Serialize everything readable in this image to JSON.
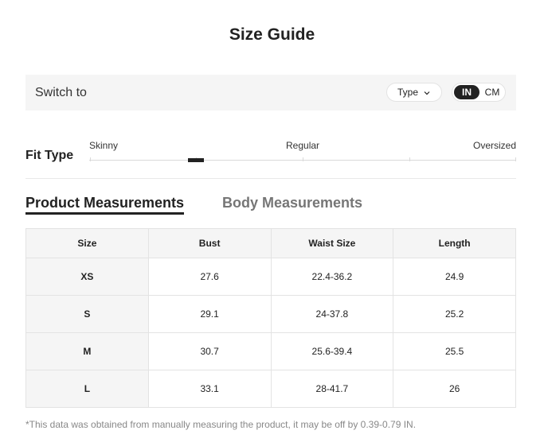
{
  "title": "Size Guide",
  "switch_bar": {
    "label": "Switch to",
    "type_dropdown": "Type",
    "unit_in": "IN",
    "unit_cm": "CM",
    "selected_unit": "IN"
  },
  "fit_type": {
    "label": "Fit Type",
    "ticks": [
      "Skinny",
      "Regular",
      "Oversized"
    ],
    "selected_position_fraction": 0.25
  },
  "tabs": [
    {
      "label": "Product Measurements",
      "active": true
    },
    {
      "label": "Body Measurements",
      "active": false
    }
  ],
  "table": {
    "headers": [
      "Size",
      "Bust",
      "Waist Size",
      "Length"
    ],
    "rows": [
      [
        "XS",
        "27.6",
        "22.4-36.2",
        "24.9"
      ],
      [
        "S",
        "29.1",
        "24-37.8",
        "25.2"
      ],
      [
        "M",
        "30.7",
        "25.6-39.4",
        "25.5"
      ],
      [
        "L",
        "33.1",
        "28-41.7",
        "26"
      ]
    ]
  },
  "footnote": "*This data was obtained from manually measuring the product, it may be off by 0.39-0.79 IN.",
  "icons": {
    "dropdown": "chevron-down-icon"
  },
  "colors": {
    "accent": "#222222",
    "panel_bg": "#f5f5f5",
    "muted_text": "#767676"
  }
}
